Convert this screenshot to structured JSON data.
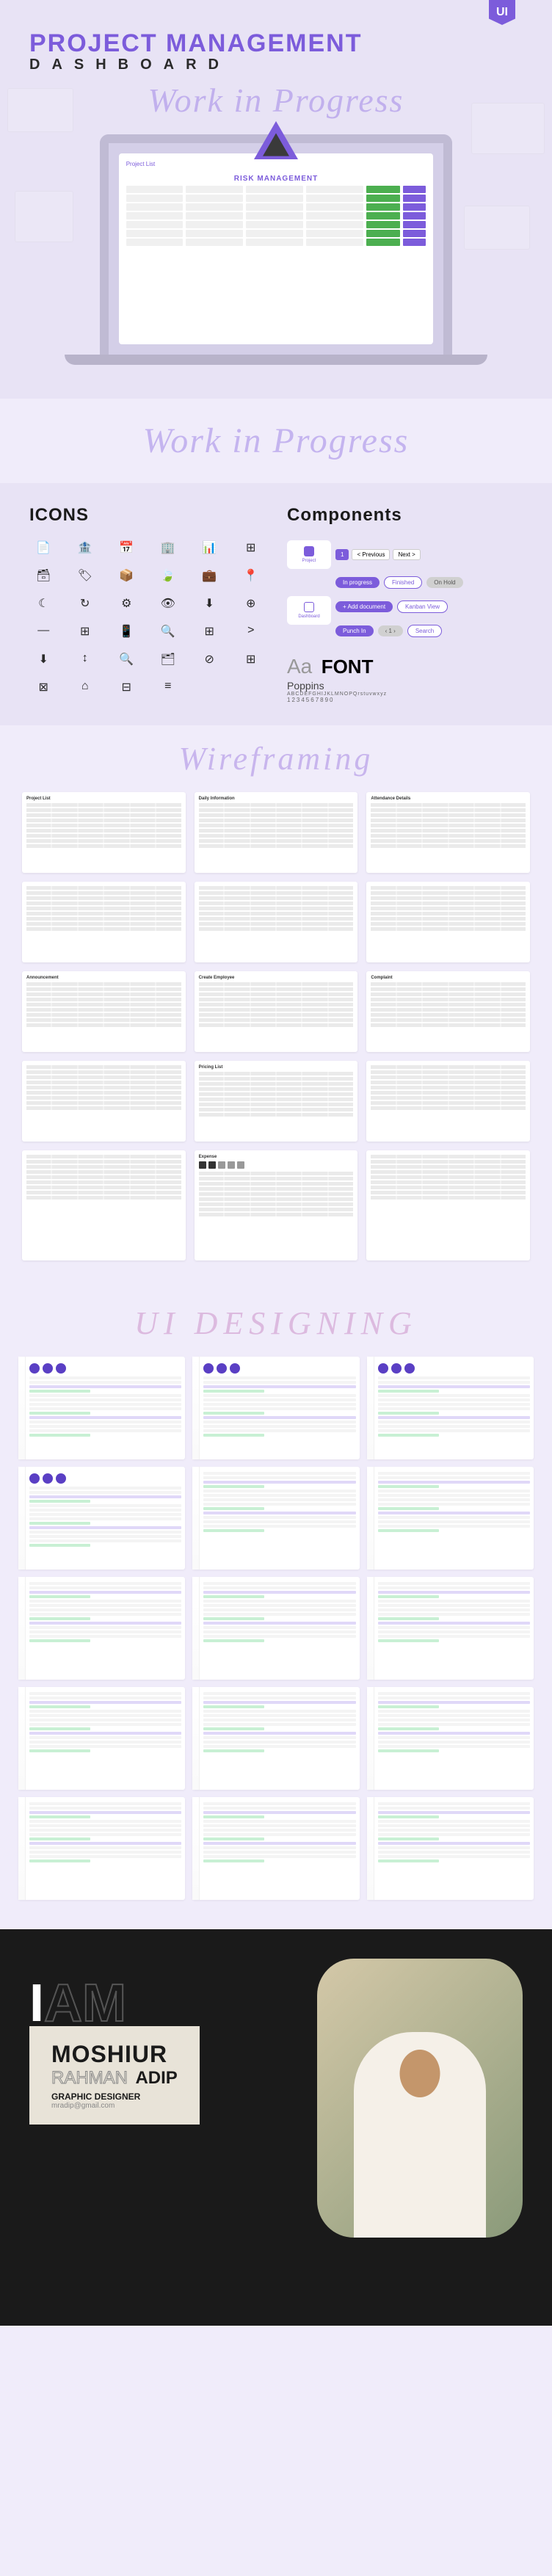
{
  "hero": {
    "title": "PROJECT MANAGEMENT",
    "subtitle": "DASHBOARD",
    "ui_tab": "UI",
    "wip": "Work in Progress",
    "screen_title": "Project List",
    "brand": "RISK MANAGEMENT"
  },
  "icons": {
    "heading": "ICONS",
    "glyphs": [
      "📄",
      "🏦",
      "📅",
      "🏢",
      "📊",
      "⊞",
      "🗃",
      "🏷",
      "📦",
      "🍃",
      "💼",
      "📍",
      "☾",
      "↻",
      "⚙",
      "👁",
      "⬇",
      "⊕",
      "—",
      "⊞",
      "📱",
      "🔍",
      "⊞",
      ">",
      "⬇",
      "↕",
      "🔍",
      "🗂",
      "⊘",
      "⊞",
      "⊠",
      "⌂",
      "⊟",
      "≡"
    ]
  },
  "components": {
    "heading": "Components",
    "nav_items": [
      "Project",
      "Dashboard"
    ],
    "pager": {
      "page": "1",
      "prev": "< Previous",
      "next": "Next >"
    },
    "chips_row1": [
      "In progress",
      "Finished",
      "On Hold"
    ],
    "chips_row2": [
      "+ Add document",
      "Kanban View"
    ],
    "chips_row3": [
      "Punch In"
    ],
    "search_chip": "Search",
    "font_label": "FONT",
    "font_name": "Poppins",
    "alphabet_upper": "ABCDEFGHIJKLMNOPQ",
    "alphabet_lower": "rstuvwxyz",
    "numbers": "1234567890"
  },
  "wireframing": {
    "heading": "Wireframing",
    "mocks": [
      "Project List",
      "Daily Information",
      "Attendance Details",
      "",
      "",
      "",
      "Announcement",
      "Create Employee",
      "Complaint",
      "",
      "Pricing List",
      "",
      "",
      "Expense",
      ""
    ]
  },
  "ui_designing": {
    "heading": "UI DESIGNING",
    "mock_count": 15
  },
  "footer": {
    "i": "I",
    "am": "AM",
    "name_first": "MOSHIUR",
    "name_mid": "RAHMAN",
    "name_last": "ADIP",
    "role": "GRAPHIC DESIGNER",
    "email": "mradip@gmail.com"
  }
}
